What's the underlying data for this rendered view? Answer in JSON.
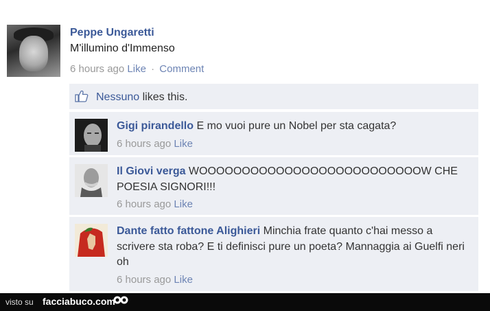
{
  "post": {
    "author": "Peppe Ungaretti",
    "text": "M'illumino d'Immenso",
    "time": "6 hours ago",
    "like_label": "Like",
    "separator": "·",
    "comment_label": "Comment"
  },
  "likes": {
    "name": "Nessuno",
    "text": " likes this."
  },
  "comments": [
    {
      "author": "Gigi pirandello",
      "text": " E mo vuoi pure un Nobel per sta cagata?",
      "time": "6 hours ago",
      "like_label": "Like"
    },
    {
      "author": "Il Giovi verga",
      "text": " WOOOOOOOOOOOOOOOOOOOOOOOOOOW CHE POESIA SIGNORI!!!",
      "time": "6 hours ago",
      "like_label": "Like"
    },
    {
      "author": "Dante fatto fattone Alighieri",
      "text": " Minchia frate quanto c'hai messo a scrivere sta roba? E ti definisci pure un poeta? Mannaggia ai Guelfi neri oh",
      "time": "6 hours ago",
      "like_label": "Like"
    }
  ],
  "footer": {
    "visto": "visto su",
    "site": "facciabuco.com"
  }
}
